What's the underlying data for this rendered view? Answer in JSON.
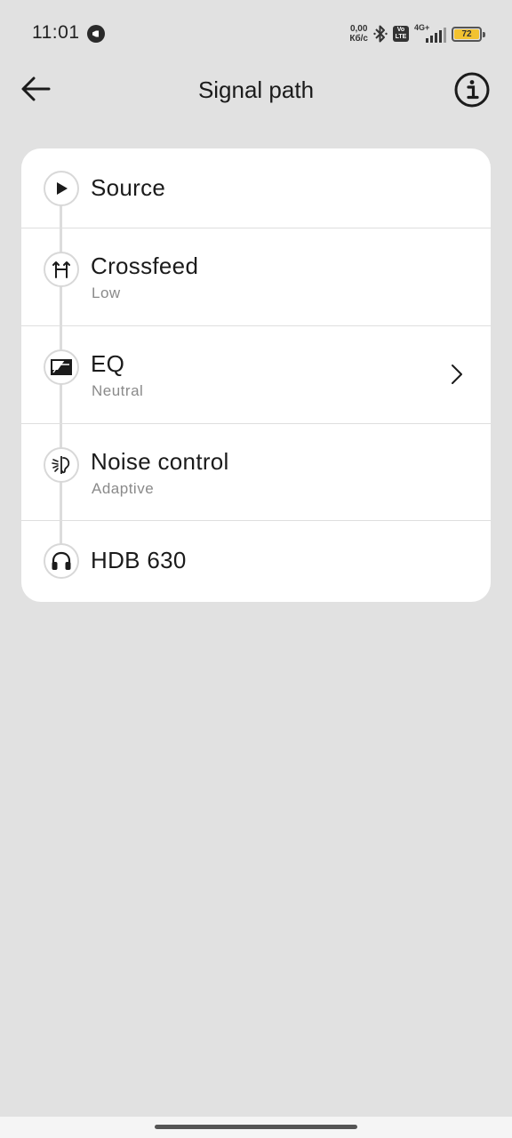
{
  "status_bar": {
    "time": "11:01",
    "speed_value": "0,00",
    "speed_unit": "Кб/с",
    "volte_top": "Vo",
    "volte_bottom": "LTE",
    "network": "4G+",
    "battery": "72",
    "battery_color": "#f2c230"
  },
  "app_bar": {
    "title": "Signal path",
    "back_icon": "arrow-left-icon",
    "info_icon": "info-icon"
  },
  "signal_path": [
    {
      "title": "Source",
      "subtitle": "",
      "icon": "play-icon",
      "has_chevron": false
    },
    {
      "title": "Crossfeed",
      "subtitle": "Low",
      "icon": "crossfeed-icon",
      "has_chevron": false
    },
    {
      "title": "EQ",
      "subtitle": "Neutral",
      "icon": "eq-icon",
      "has_chevron": true
    },
    {
      "title": "Noise control",
      "subtitle": "Adaptive",
      "icon": "noise-control-icon",
      "has_chevron": false
    },
    {
      "title": "HDB 630",
      "subtitle": "",
      "icon": "headphones-icon",
      "has_chevron": false
    }
  ]
}
